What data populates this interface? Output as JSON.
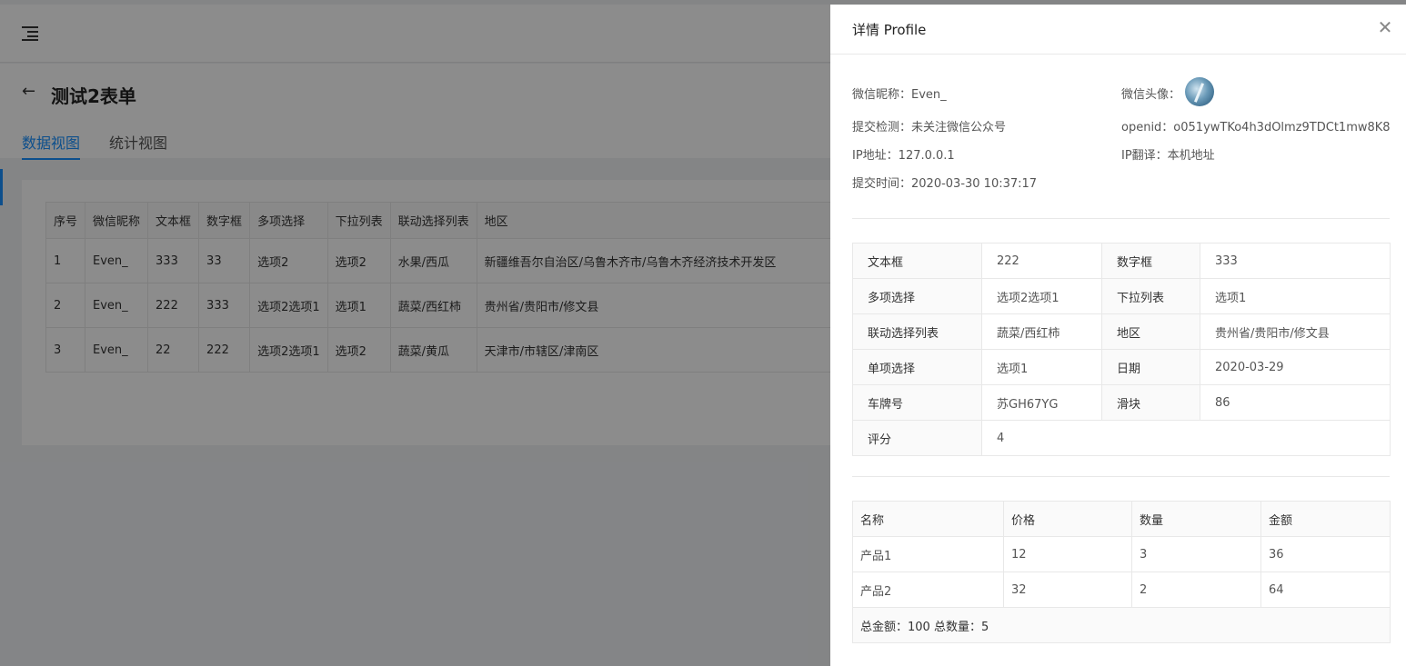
{
  "header": {
    "title": "测试2表单"
  },
  "tabs": [
    {
      "label": "数据视图",
      "active": true
    },
    {
      "label": "统计视图",
      "active": false
    }
  ],
  "list_table": {
    "columns": [
      "序号",
      "微信昵称",
      "文本框",
      "数字框",
      "多项选择",
      "下拉列表",
      "联动选择列表",
      "地区"
    ],
    "rows": [
      [
        "1",
        "Even_",
        "333",
        "33",
        "选项2",
        "选项2",
        "水果/西瓜",
        "新疆维吾尔自治区/乌鲁木齐市/乌鲁木齐经济技术开发区"
      ],
      [
        "2",
        "Even_",
        "222",
        "333",
        "选项2选项1",
        "选项1",
        "蔬菜/西红柿",
        "贵州省/贵阳市/修文县"
      ],
      [
        "3",
        "Even_",
        "22",
        "222",
        "选项2选项1",
        "选项2",
        "蔬菜/黄瓜",
        "天津市/市辖区/津南区"
      ]
    ]
  },
  "drawer": {
    "title": "详情 Profile",
    "info": {
      "nickname": "微信昵称：Even_",
      "avatar_label": "微信头像：",
      "submit_check": "提交检测：未关注微信公众号",
      "openid": "openid：o051ywTKo4h3dOlmz9TDCt1mw8K8",
      "ip": "IP地址：127.0.0.1",
      "ip_translate": "IP翻译：本机地址",
      "submit_time": "提交时间：2020-03-30 10:37:17"
    },
    "details": [
      [
        "文本框",
        "222",
        "数字框",
        "333"
      ],
      [
        "多项选择",
        "选项2选项1",
        "下拉列表",
        "选项1"
      ],
      [
        "联动选择列表",
        "蔬菜/西红柿",
        "地区",
        "贵州省/贵阳市/修文县"
      ],
      [
        "单项选择",
        "选项1",
        "日期",
        "2020-03-29"
      ],
      [
        "车牌号",
        "苏GH67YG",
        "滑块",
        "86"
      ],
      [
        "评分",
        "4"
      ]
    ],
    "products": {
      "columns": [
        "名称",
        "价格",
        "数量",
        "金额"
      ],
      "rows": [
        [
          "产品1",
          "12",
          "3",
          "36"
        ],
        [
          "产品2",
          "32",
          "2",
          "64"
        ]
      ],
      "total": "总金额：100 总数量：5"
    }
  },
  "colors": {
    "primary": "#1890ff",
    "mask": "rgba(0,0,0,0.45)"
  },
  "icons": {
    "menu": "menu-fold-icon",
    "back": "arrow-left-icon",
    "close": "close-icon"
  }
}
